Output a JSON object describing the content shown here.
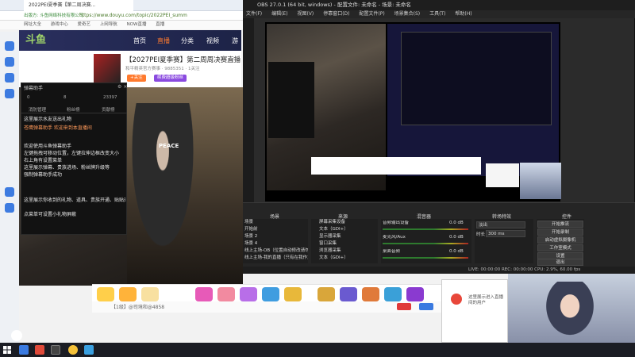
{
  "browser": {
    "tab_title": "2022PEI夏季赛【第二周决赛...",
    "url": "https://www.douyu.com/topic/2022PEI_summ",
    "url_prefix": "出版方: 斗鱼网络科技有限公司",
    "bookmarks": [
      "网址大全",
      "游戏中心",
      "爱奇艺",
      "上网导航",
      "NOW直播",
      "直播"
    ]
  },
  "douyu": {
    "logo": "斗鱼",
    "nav": [
      "首页",
      "直播",
      "分类",
      "视频",
      "游"
    ],
    "room_title": "【2027PEI夏季赛】第二周周决赛直播",
    "room_meta": "和平精英官方赛事 · 9885351 · 1关注",
    "room_btn_follow": "+关注",
    "room_btn_sub": "续费超级粉丝",
    "room_tag": "分组"
  },
  "chat": {
    "header": "弹幕助手",
    "stats": [
      "0",
      "8",
      "23397"
    ],
    "tabs": [
      "消防管理",
      "粉丝榜",
      "贡献榜"
    ],
    "lines": [
      "这里展示水友送出礼物",
      "苍鹰弹幕助手  欢迎来到本直播间",
      "",
      "欢迎使用斗鱼弹幕助手",
      "左键拖拽可移动位置，左键拉伸边框改变大小",
      "右上角有设置菜单",
      "这里展示弹幕、贵族进场、粉丝牌升级等",
      "强制弹幕助手成功",
      "",
      "这里展示你收到的礼物、道具、贵族开通、贴贴开通",
      "点菜单可设置小礼物屏蔽"
    ]
  },
  "gift_bar": {
    "text": "【1级】@司境和@4858"
  },
  "obs": {
    "title": "OBS 27.0.1 (64 bit, windows) - 配置文件: 未命名 - 场景: 未命名",
    "menu": [
      "文件(F)",
      "编辑(E)",
      "视图(V)",
      "停靠窗口(D)",
      "配置文件(P)",
      "场景集合(S)",
      "工具(T)",
      "帮助(H)"
    ],
    "dock_scenes": "场景",
    "dock_sources": "来源",
    "dock_mixer": "混音器",
    "dock_transitions": "转场特效",
    "dock_controls": "控件",
    "scenes": [
      "场景",
      "开始前",
      "场景 2",
      "场景 4",
      "线上主场-OB（位置自动修改请勿删除）",
      "线上主场-我的直播（只有在我作为主持者时调用）"
    ],
    "sources": [
      "屏幕采集设备",
      "文本（GDI+）",
      "显示器采集",
      "窗口采集",
      "浏览器采集",
      "文本（GDI+）"
    ],
    "mixer": [
      {
        "name": "音频输出设备",
        "db": "0.0 dB",
        "level": 0.62
      },
      {
        "name": "麦克风/Aux",
        "db": "0.0 dB",
        "level": 0.45
      },
      {
        "name": "桌面音频",
        "db": "0.0 dB",
        "level": 0.3
      }
    ],
    "transition_type": "淡出",
    "transition_duration_label": "时长",
    "transition_duration": "300 ms",
    "controls": [
      "开始推流",
      "开始录制",
      "启动虚拟摄像机",
      "工作室模式",
      "设置",
      "退出"
    ],
    "status": "LIVE: 00:00:00    REC: 00:00:00    CPU: 2.9%, 60.00 fps"
  },
  "viewer_panel": {
    "text": "这里展示进入直播间的用户"
  },
  "colors": {
    "douyu_orange": "#ff7a2e",
    "obs_bg": "#2b2b2b",
    "taskbar": "#1b1d24"
  }
}
